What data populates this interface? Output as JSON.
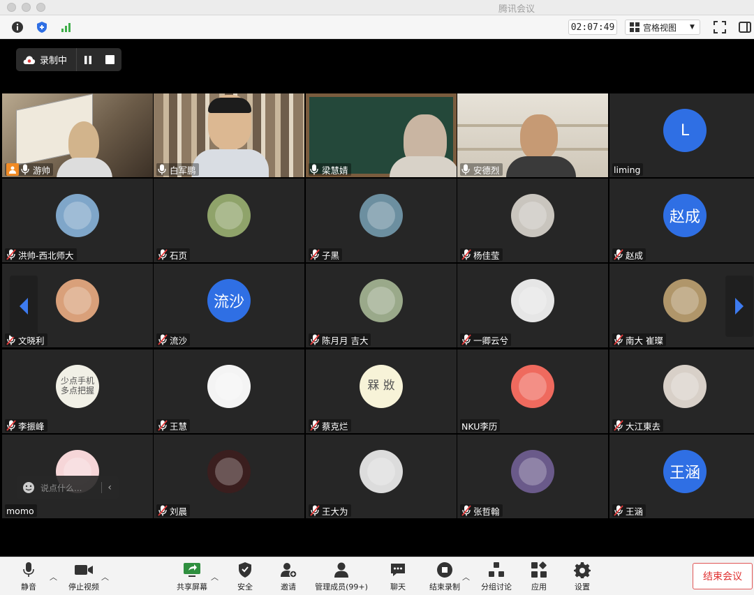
{
  "window": {
    "title": "腾讯会议"
  },
  "toolbar": {
    "timer": "02:07:49",
    "view_label": "宫格视图"
  },
  "recording": {
    "label": "录制中"
  },
  "tiles": [
    {
      "name": "游帅",
      "type": "video",
      "scene": "book"
    },
    {
      "name": "白军鹏",
      "type": "video",
      "scene": "shelf"
    },
    {
      "name": "梁慧婧",
      "type": "video",
      "scene": "board"
    },
    {
      "name": "安德烈",
      "type": "video",
      "scene": "shelf2",
      "active": true
    },
    {
      "name": "liming",
      "type": "letter",
      "avatar_text": "L",
      "avatar_color": "#2f6fe4",
      "nomic": true
    },
    {
      "name": "洪帅-西北师大",
      "type": "image",
      "avatar_color": "#7fa6c9"
    },
    {
      "name": "石页",
      "type": "image",
      "avatar_color": "#8fa36a"
    },
    {
      "name": "子黑",
      "type": "image",
      "avatar_color": "#6c8fa0"
    },
    {
      "name": "杨佳莹",
      "type": "image",
      "avatar_color": "#c9c5be"
    },
    {
      "name": "赵成",
      "type": "letter",
      "avatar_text": "赵成",
      "avatar_color": "#2f6fe4"
    },
    {
      "name": "文晓利",
      "type": "image",
      "avatar_color": "#d9a07a"
    },
    {
      "name": "流沙",
      "type": "letter",
      "avatar_text": "流沙",
      "avatar_color": "#2f6fe4"
    },
    {
      "name": "陈月月 吉大",
      "type": "image",
      "avatar_color": "#9aa98a"
    },
    {
      "name": "一卿云兮",
      "type": "image",
      "avatar_color": "#e6e6e6"
    },
    {
      "name": "南大 崔璨",
      "type": "image",
      "avatar_color": "#b0966a"
    },
    {
      "name": "李振峰",
      "type": "text",
      "avatar_lines": [
        "少点手机",
        "多点把握"
      ],
      "avatar_color": "#f1f0e6"
    },
    {
      "name": "王慧",
      "type": "image",
      "avatar_color": "#f4f4f4"
    },
    {
      "name": "蔡克烂",
      "type": "text",
      "avatar_lines": [
        "槑 敚"
      ],
      "avatar_color": "#f7f3d8"
    },
    {
      "name": "NKU李历",
      "type": "image",
      "avatar_color": "#ef6a5e",
      "nomic": true
    },
    {
      "name": "大江東去",
      "type": "image",
      "avatar_color": "#d8d0c8"
    },
    {
      "name": "momo",
      "type": "image",
      "avatar_color": "#f6d6d8",
      "nomic": true
    },
    {
      "name": "刘晨",
      "type": "image",
      "avatar_color": "#3a1e1e"
    },
    {
      "name": "王大为",
      "type": "image",
      "avatar_color": "#dcdcdc"
    },
    {
      "name": "张哲翰",
      "type": "image",
      "avatar_color": "#6a5a8a"
    },
    {
      "name": "王涵",
      "type": "letter",
      "avatar_text": "王涵",
      "avatar_color": "#2f6fe4"
    }
  ],
  "chat": {
    "placeholder": "说点什么..."
  },
  "bottombar": {
    "mute": "静音",
    "stop_video": "停止视频",
    "share": "共享屏幕",
    "security": "安全",
    "invite": "邀请",
    "members": "管理成员(99+)",
    "chat": "聊天",
    "end_record": "结束录制",
    "breakout": "分组讨论",
    "apps": "应用",
    "settings": "设置",
    "end_meeting": "结束会议"
  }
}
